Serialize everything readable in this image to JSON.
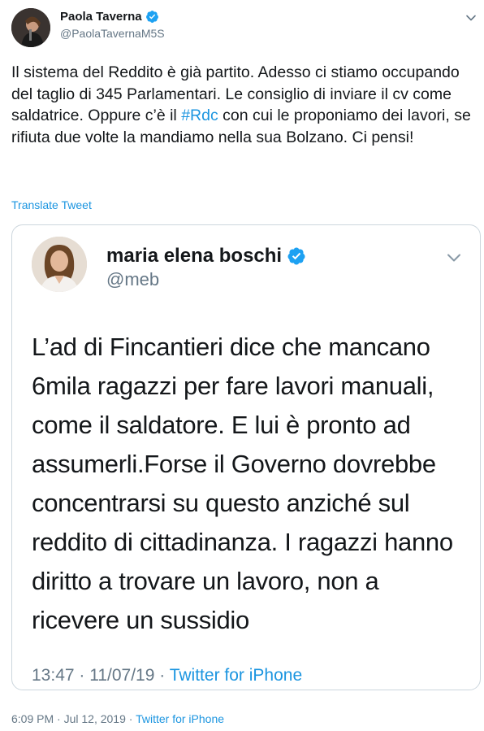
{
  "author": {
    "name": "Paola Taverna",
    "handle": "@PaolaTavernaM5S"
  },
  "tweet": {
    "text_before": "Il sistema del Reddito è già partito. Adesso ci stiamo occupando del taglio di 345 Parlamentari. Le consiglio di inviare il cv come saldatrice. Oppure c’è il ",
    "hashtag": "#Rdc",
    "text_after": " con cui le proponiamo dei lavori, se rifiuta due volte la mandiamo nella sua Bolzano. Ci pensi!",
    "translate_label": "Translate Tweet"
  },
  "quoted": {
    "name": "maria elena boschi",
    "handle": "@meb",
    "text": "L’ad di Fincantieri dice che mancano 6mila ragazzi per fare lavori manuali, come il saldatore. E lui è pronto ad assumerli.Forse il Governo dovrebbe concentrarsi su questo anziché sul reddito di cittadinanza. I ragazzi hanno diritto a trovare un lavoro, non a ricevere un sussidio",
    "time": "13:47",
    "sep": " · ",
    "date": "11/07/19",
    "source": "Twitter for iPhone"
  },
  "meta": {
    "timestamp": "6:09 PM · Jul 12, 2019",
    "sep": " · ",
    "source": "Twitter for iPhone"
  },
  "colors": {
    "link": "#1b95e0",
    "secondary_text": "#657786",
    "border": "#ccd6dd"
  },
  "icons": {
    "verified": "verified-badge-icon",
    "caret": "chevron-down-icon"
  }
}
